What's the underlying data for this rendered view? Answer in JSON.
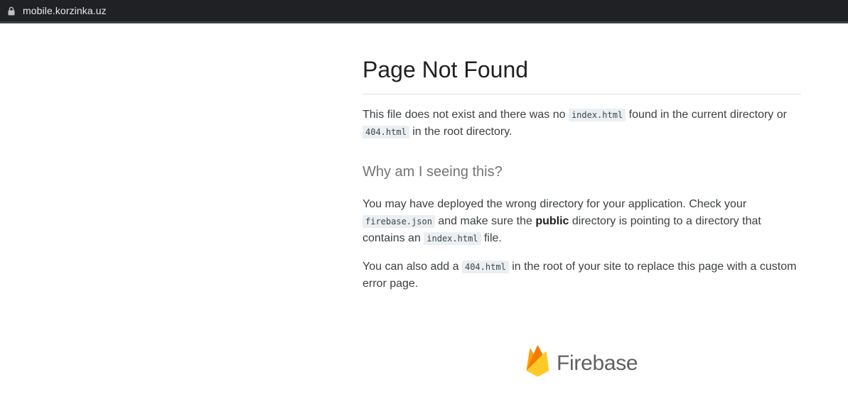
{
  "browser": {
    "url": "mobile.korzinka.uz",
    "lock_icon": "lock-icon"
  },
  "page": {
    "title": "Page Not Found",
    "p1": {
      "t1": "This file does not exist and there was no ",
      "c1": "index.html",
      "t2": " found in the current directory or ",
      "c2": "404.html",
      "t3": " in the root directory."
    },
    "subtitle": "Why am I seeing this?",
    "p2": {
      "t1": "You may have deployed the wrong directory for your application. Check your ",
      "c1": "firebase.json",
      "t2": " and make sure the ",
      "b1": "public",
      "t3": " directory is pointing to a directory that contains an ",
      "c2": "index.html",
      "t4": " file."
    },
    "p3": {
      "t1": "You can also add a ",
      "c1": "404.html",
      "t2": " in the root of your site to replace this page with a custom error page."
    }
  },
  "logo": {
    "icon": "firebase-flame-icon",
    "text": "Firebase",
    "colors": [
      "#FFA000",
      "#F57C00",
      "#FFCA28"
    ]
  }
}
